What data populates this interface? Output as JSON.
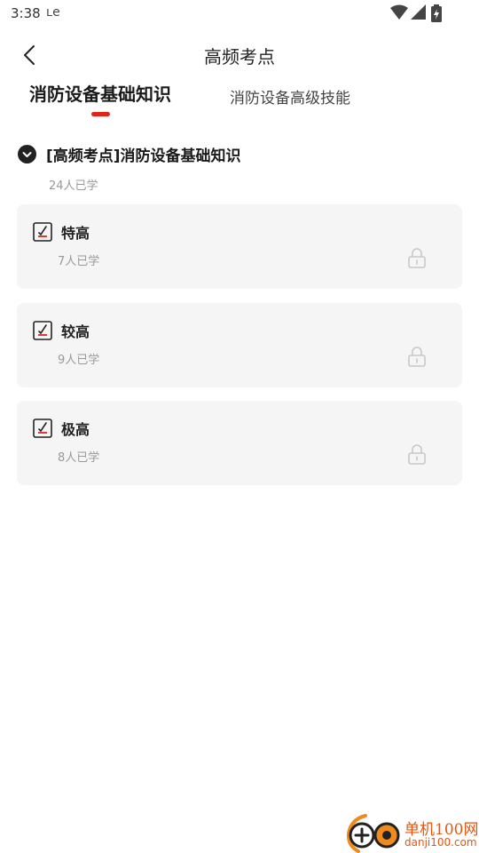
{
  "status_bar": {
    "time": "3:38",
    "notification_glyph": "ʟe",
    "icons": [
      "wifi-icon",
      "signal-icon",
      "battery-icon"
    ]
  },
  "nav": {
    "back_icon": "chevron-left-icon",
    "title": "高频考点"
  },
  "tabs": [
    {
      "label": "消防设备基础知识",
      "active": true
    },
    {
      "label": "消防设备高级技能",
      "active": false
    }
  ],
  "section": {
    "icon": "chevron-down-icon",
    "title": "[高频考点]消防设备基础知识",
    "count": "24人已学"
  },
  "cards": [
    {
      "title": "特高",
      "count": "7人已学",
      "icon": "exam-paper-icon",
      "locked": true
    },
    {
      "title": "较高",
      "count": "9人已学",
      "icon": "exam-paper-icon",
      "locked": true
    },
    {
      "title": "极高",
      "count": "8人已学",
      "icon": "exam-paper-icon",
      "locked": true
    }
  ],
  "watermark": {
    "name": "单机100网",
    "url": "danji100.com"
  },
  "colors": {
    "accent": "#e2231a",
    "card_bg": "#f5f5f5",
    "muted_text": "#999999",
    "lock": "#c8c8c8",
    "watermark": "#e8540c"
  }
}
